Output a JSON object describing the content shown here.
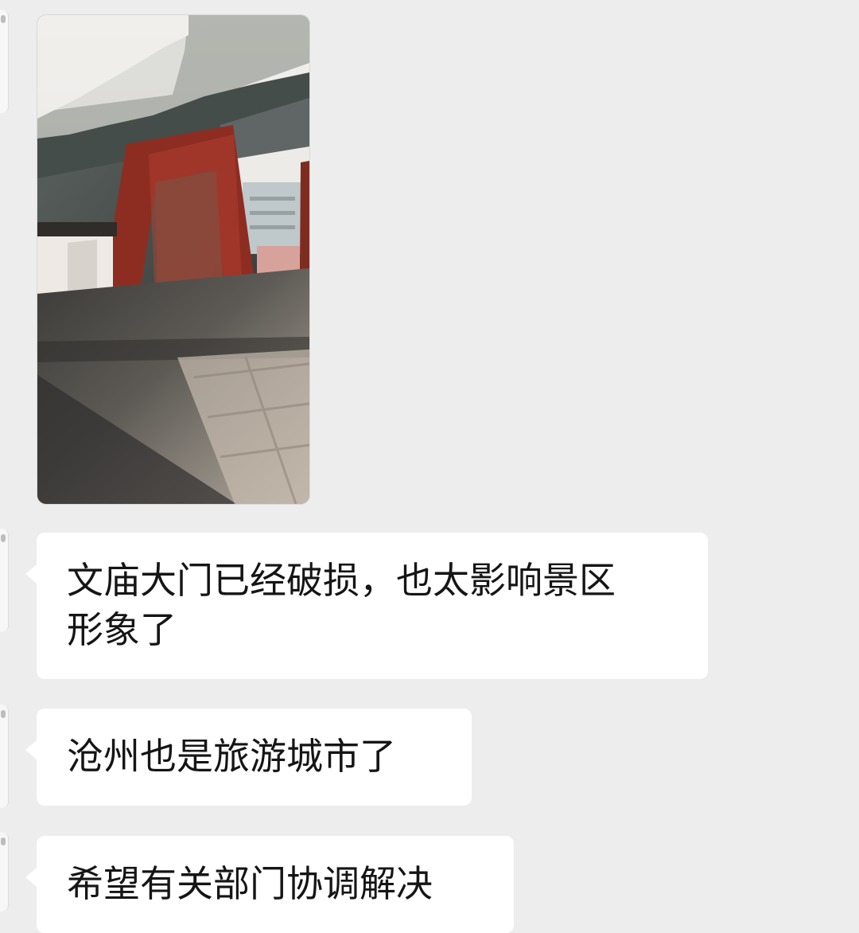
{
  "colors": {
    "background": "#ededed",
    "bubble": "#ffffff",
    "text": "#151515"
  },
  "messages": [
    {
      "type": "image",
      "icon": "photo-icon"
    },
    {
      "type": "text",
      "lines": [
        "文庙大门已经破损，也太影响景区",
        "形象了"
      ]
    },
    {
      "type": "text",
      "lines": [
        "沧州也是旅游城市了"
      ]
    },
    {
      "type": "text",
      "lines": [
        "希望有关部门协调解决"
      ]
    }
  ]
}
